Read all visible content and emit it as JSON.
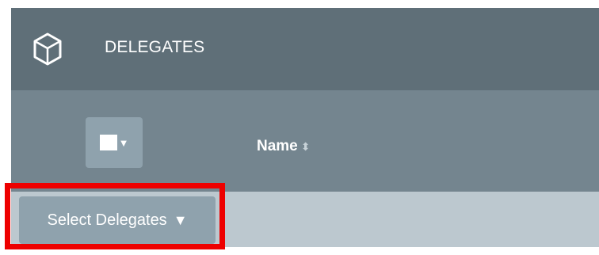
{
  "header": {
    "title": "DELEGATES",
    "icon": "cube-icon"
  },
  "table": {
    "columns": [
      {
        "label": "Name",
        "sortable": true
      }
    ],
    "select_all_icon": "checkbox-dropdown-icon"
  },
  "bulk_action": {
    "label": "Select Delegates",
    "arrow": "▼"
  },
  "colors": {
    "header_bg": "#5f6f78",
    "column_header_bg": "#74858f",
    "row_bg": "#bcc8cf",
    "button_bg": "#8fa2ad",
    "highlight": "#ee0000"
  }
}
